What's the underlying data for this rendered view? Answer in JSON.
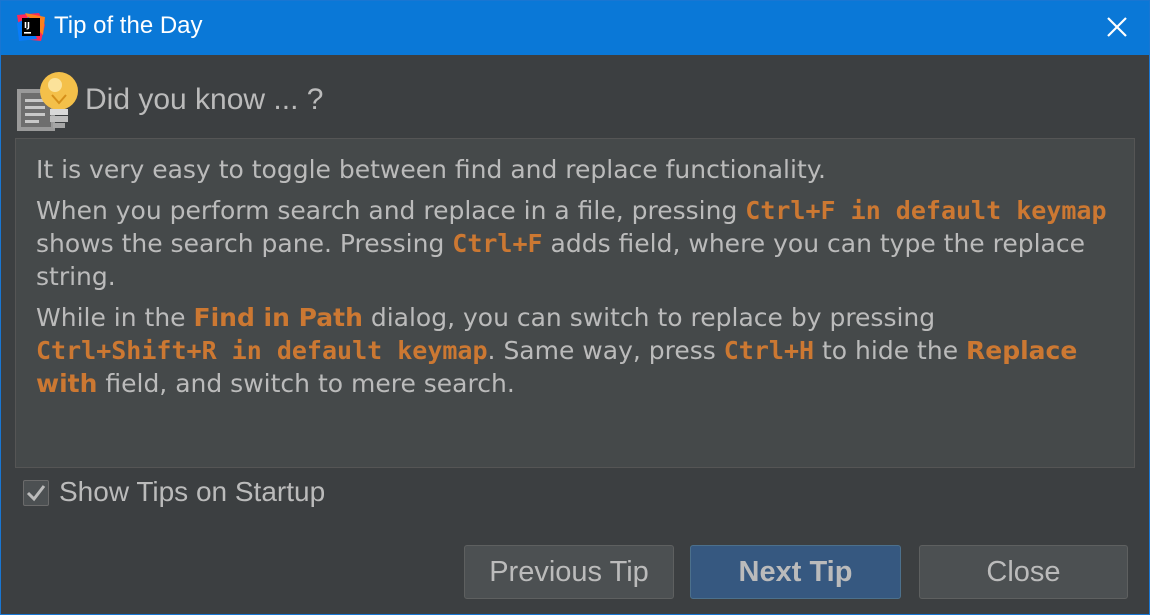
{
  "window": {
    "title": "Tip of the Day"
  },
  "header": {
    "title": "Did you know ... ?"
  },
  "tip": {
    "p1": "It is very easy to toggle between find and replace functionality.",
    "p2": {
      "t1": "When you perform search and replace in a file, pressing ",
      "s1": "Ctrl+F in default keymap",
      "t2": " shows the search pane. Pressing ",
      "s2": "Ctrl+F",
      "t3": " adds field, where you can type the replace string."
    },
    "p3": {
      "t1": "While in the ",
      "h1": "Find in Path",
      "t2": " dialog, you can switch to replace by pressing ",
      "s1": "Ctrl+Shift+R in default keymap",
      "t3": ". Same way, press ",
      "s2": "Ctrl+H",
      "t4": " to hide the ",
      "h2": "Replace with",
      "t5": " field, and switch to mere search."
    }
  },
  "options": {
    "show_tips_label": "Show Tips on Startup",
    "show_tips_checked": true
  },
  "buttons": {
    "previous": "Previous Tip",
    "next": "Next Tip",
    "close": "Close"
  },
  "colors": {
    "titlebar": "#0a78d7",
    "background": "#3c3f41",
    "content_bg": "#45494a",
    "text": "#bbbbbb",
    "accent": "#cc7832",
    "default_button": "#365880"
  }
}
